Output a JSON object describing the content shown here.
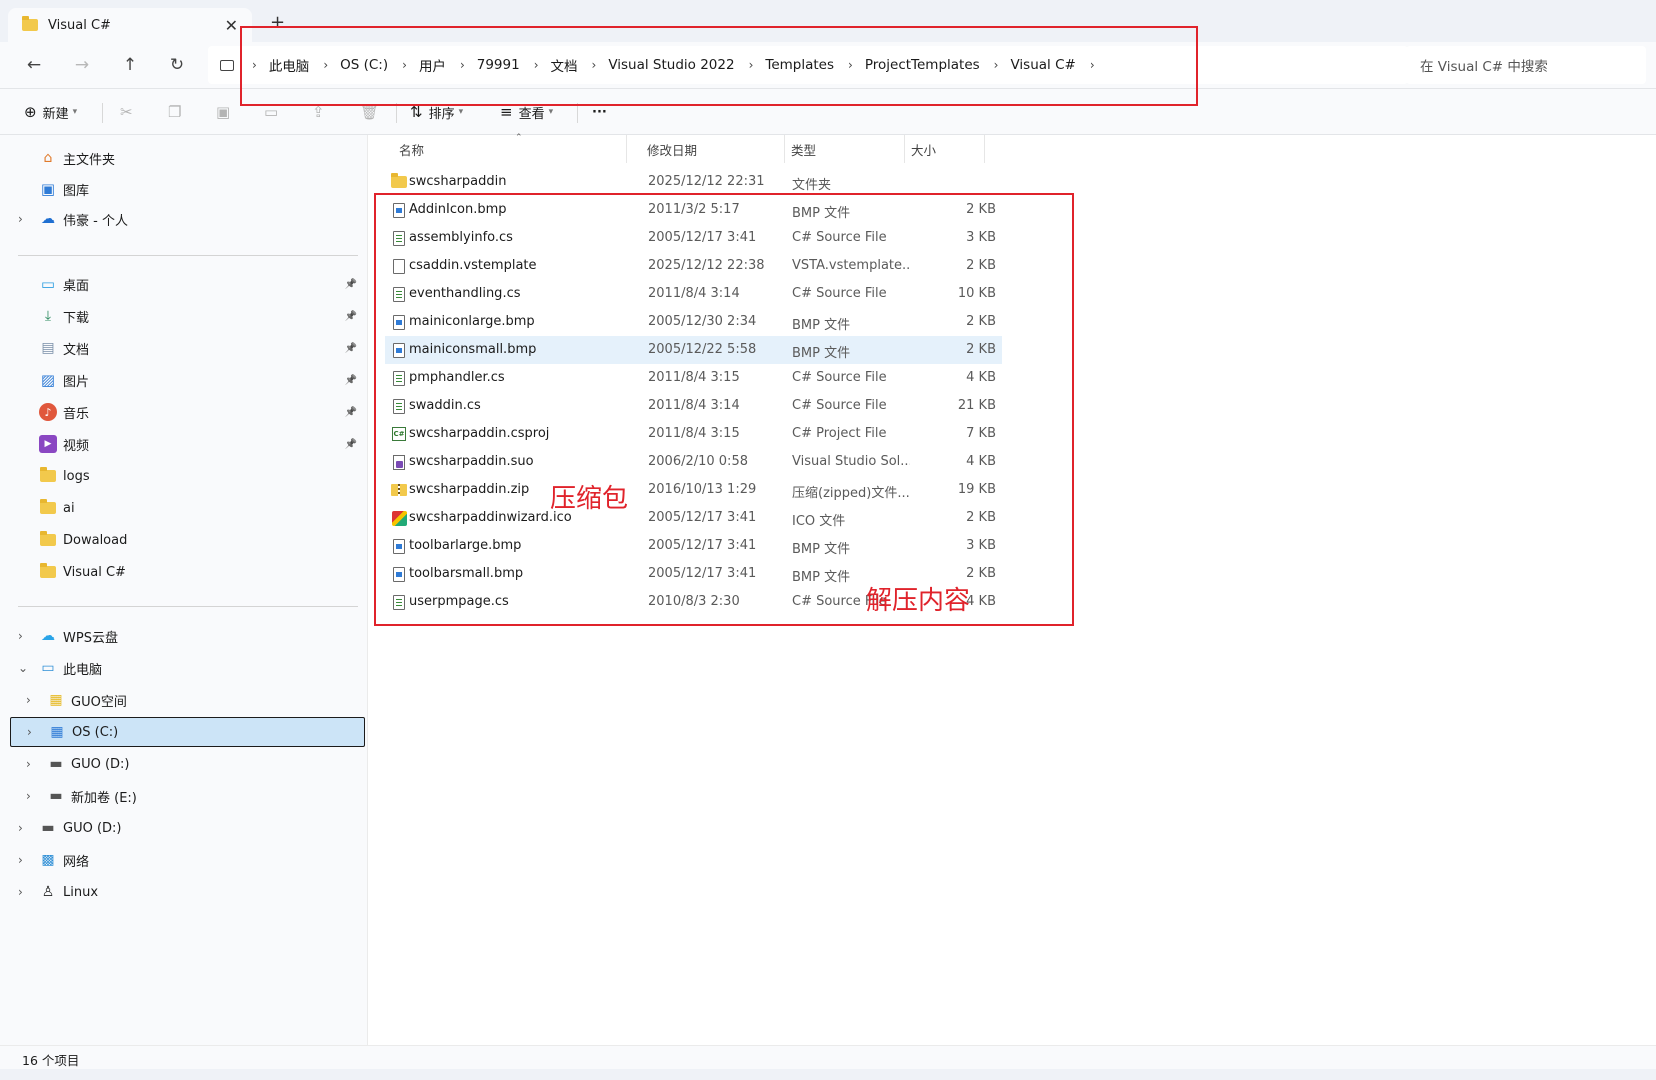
{
  "window": {
    "tab_title": "Visual C#",
    "new_tab": "+",
    "close": "✕"
  },
  "nav": {
    "back": "←",
    "forward": "→",
    "up": "↑",
    "refresh": "↻",
    "computer_icon": "computer-icon"
  },
  "breadcrumb": [
    {
      "label": "此电脑"
    },
    {
      "label": "OS (C:)"
    },
    {
      "label": "用户"
    },
    {
      "label": "79991"
    },
    {
      "label": "文档"
    },
    {
      "label": "Visual Studio 2022"
    },
    {
      "label": "Templates"
    },
    {
      "label": "ProjectTemplates"
    },
    {
      "label": "Visual C#"
    }
  ],
  "search": {
    "placeholder": "在 Visual C# 中搜索"
  },
  "toolbar": {
    "new_label": "新建",
    "sort_label": "排序",
    "view_label": "查看",
    "more_label": "···"
  },
  "sidebar": {
    "quick": [
      {
        "label": "主文件夹",
        "icon": "home-icon",
        "color": "#e07a2b"
      },
      {
        "label": "图库",
        "icon": "gallery-icon",
        "color": "#2f7bd6"
      },
      {
        "label": "伟豪 - 个人",
        "icon": "onedrive-icon",
        "color": "#1f6fd1"
      }
    ],
    "pinned": [
      {
        "label": "桌面",
        "icon": "desktop-icon",
        "color": "#2f9fe0"
      },
      {
        "label": "下载",
        "icon": "download-icon",
        "color": "#2b8a5e"
      },
      {
        "label": "文档",
        "icon": "documents-icon",
        "color": "#7a8fa8"
      },
      {
        "label": "图片",
        "icon": "pictures-icon",
        "color": "#2f7bd6"
      },
      {
        "label": "音乐",
        "icon": "music-icon",
        "color": "#e0573c"
      },
      {
        "label": "视频",
        "icon": "videos-icon",
        "color": "#8a47c2"
      },
      {
        "label": "logs",
        "icon": "folder-icon",
        "color": "#f2c94c"
      },
      {
        "label": "ai",
        "icon": "folder-icon",
        "color": "#f2c94c"
      },
      {
        "label": "Dowaload",
        "icon": "folder-icon",
        "color": "#f2c94c"
      },
      {
        "label": "Visual C#",
        "icon": "folder-icon",
        "color": "#f2c94c"
      }
    ],
    "tree": [
      {
        "label": "WPS云盘",
        "icon": "cloud-icon",
        "color": "#2aa4e8"
      },
      {
        "label": "此电脑",
        "icon": "computer-icon",
        "color": "#2f8fd6"
      },
      {
        "label": "GUO空间",
        "icon": "space-icon",
        "color": "#e6b820"
      },
      {
        "label": "OS (C:)",
        "icon": "os-drive-icon",
        "color": "#2f7bd6"
      },
      {
        "label": "GUO (D:)",
        "icon": "drive-icon",
        "color": "#555555"
      },
      {
        "label": "新加卷 (E:)",
        "icon": "drive-icon",
        "color": "#555555"
      },
      {
        "label": "GUO (D:)",
        "icon": "drive-icon",
        "color": "#555555"
      },
      {
        "label": "网络",
        "icon": "network-icon",
        "color": "#2f8fd6"
      },
      {
        "label": "Linux",
        "icon": "linux-icon",
        "color": "#222222"
      }
    ]
  },
  "columns": {
    "name": "名称",
    "modified": "修改日期",
    "type": "类型",
    "size": "大小"
  },
  "files": [
    {
      "name": "swcsharpaddin",
      "modified": "2025/12/12 22:31",
      "type": "文件夹",
      "size": "",
      "icon": "folder"
    },
    {
      "name": "AddinIcon.bmp",
      "modified": "2011/3/2 5:17",
      "type": "BMP 文件",
      "size": "2 KB",
      "icon": "bmp"
    },
    {
      "name": "assemblyinfo.cs",
      "modified": "2005/12/17 3:41",
      "type": "C# Source File",
      "size": "3 KB",
      "icon": "cs"
    },
    {
      "name": "csaddin.vstemplate",
      "modified": "2025/12/12 22:38",
      "type": "VSTA.vstemplate...",
      "size": "2 KB",
      "icon": "blank"
    },
    {
      "name": "eventhandling.cs",
      "modified": "2011/8/4 3:14",
      "type": "C# Source File",
      "size": "10 KB",
      "icon": "cs"
    },
    {
      "name": "mainiconlarge.bmp",
      "modified": "2005/12/30 2:34",
      "type": "BMP 文件",
      "size": "2 KB",
      "icon": "bmp"
    },
    {
      "name": "mainiconsmall.bmp",
      "modified": "2005/12/22 5:58",
      "type": "BMP 文件",
      "size": "2 KB",
      "icon": "bmp"
    },
    {
      "name": "pmphandler.cs",
      "modified": "2011/8/4 3:15",
      "type": "C# Source File",
      "size": "4 KB",
      "icon": "cs"
    },
    {
      "name": "swaddin.cs",
      "modified": "2011/8/4 3:14",
      "type": "C# Source File",
      "size": "21 KB",
      "icon": "cs"
    },
    {
      "name": "swcsharpaddin.csproj",
      "modified": "2011/8/4 3:15",
      "type": "C# Project File",
      "size": "7 KB",
      "icon": "csproj"
    },
    {
      "name": "swcsharpaddin.suo",
      "modified": "2006/2/10 0:58",
      "type": "Visual Studio Sol...",
      "size": "4 KB",
      "icon": "suo"
    },
    {
      "name": "swcsharpaddin.zip",
      "modified": "2016/10/13 1:29",
      "type": "压缩(zipped)文件...",
      "size": "19 KB",
      "icon": "zip"
    },
    {
      "name": "swcsharpaddinwizard.ico",
      "modified": "2005/12/17 3:41",
      "type": "ICO 文件",
      "size": "2 KB",
      "icon": "ico"
    },
    {
      "name": "toolbarlarge.bmp",
      "modified": "2005/12/17 3:41",
      "type": "BMP 文件",
      "size": "3 KB",
      "icon": "bmp"
    },
    {
      "name": "toolbarsmall.bmp",
      "modified": "2005/12/17 3:41",
      "type": "BMP 文件",
      "size": "2 KB",
      "icon": "bmp"
    },
    {
      "name": "userpmpage.cs",
      "modified": "2010/8/3 2:30",
      "type": "C# Source File",
      "size": "4 KB",
      "icon": "cs"
    }
  ],
  "status": {
    "item_count": "16 个项目"
  },
  "annotations": {
    "zip_label": "压缩包",
    "extracted_label": "解压内容",
    "color": "#e0232b"
  },
  "colors": {
    "selection": "#cce4f7",
    "hover": "#e5f1fb",
    "chrome": "#f9fafc",
    "tabstrip": "#eff2f7"
  }
}
